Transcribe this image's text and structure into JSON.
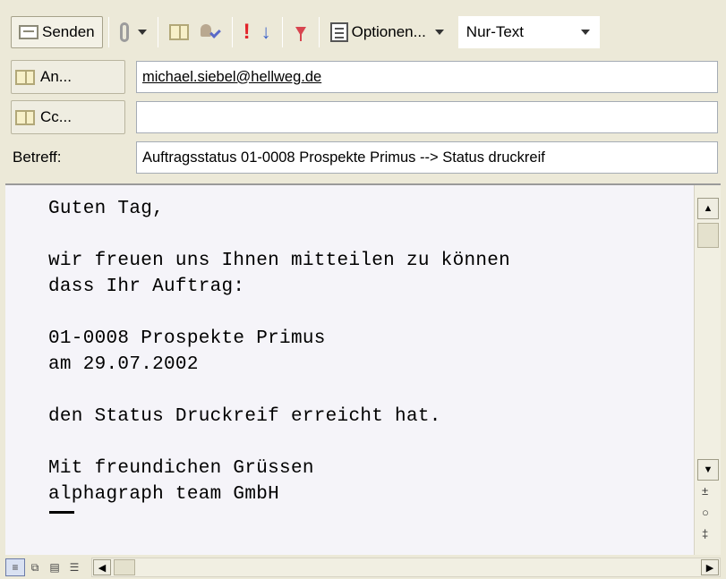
{
  "toolbar": {
    "send_label": "Senden",
    "options_label": "Optionen...",
    "format_value": "Nur-Text"
  },
  "fields": {
    "to_label": "An...",
    "to_value": "michael.siebel@hellweg.de",
    "cc_label": "Cc...",
    "cc_value": "",
    "subject_label": "Betreff:",
    "subject_value": "Auftragsstatus 01-0008 Prospekte Primus --> Status druckreif"
  },
  "body": {
    "lines": [
      "Guten Tag,",
      "",
      "wir freuen uns Ihnen mitteilen zu können",
      "dass Ihr Auftrag:",
      "",
      "01-0008 Prospekte Primus",
      "am 29.07.2002",
      "",
      "den Status Druckreif erreicht hat.",
      "",
      "Mit freundichen Grüssen",
      "alphagraph team GmbH"
    ]
  },
  "icons": {
    "send": "envelope-icon",
    "attach": "paperclip-icon",
    "address_book": "address-book-icon",
    "check_names": "check-names-icon",
    "importance_high": "importance-high-icon",
    "importance_low": "importance-low-icon",
    "flag": "flag-icon",
    "options": "options-icon"
  },
  "colors": {
    "window_bg": "#ece9d8",
    "importance_high": "#e2242a",
    "importance_low": "#3d63c9",
    "flag": "#d8454f"
  }
}
